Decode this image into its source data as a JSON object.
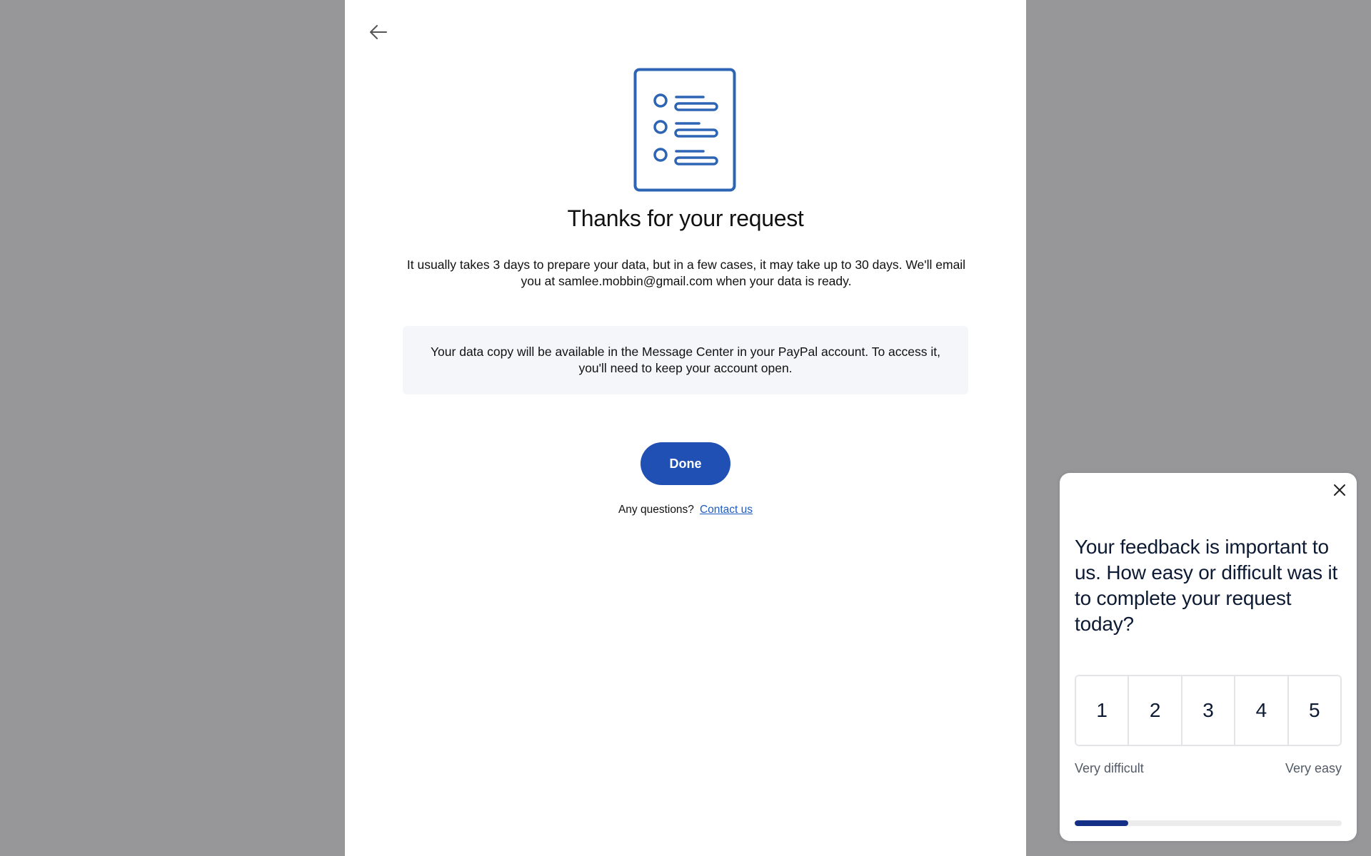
{
  "main": {
    "title": "Thanks for your request",
    "description": "It usually takes 3 days to prepare your data, but in a few cases, it may take up to 30 days. We'll email you at samlee.mobbin@gmail.com when your data is ready.",
    "info_box": "Your data copy will be available in the Message Center in your PayPal account. To access it, you'll need to keep your account open.",
    "done_label": "Done",
    "questions_label": "Any questions?",
    "contact_link": "Contact us"
  },
  "icons": {
    "back": "arrow-left-icon",
    "illustration": "document-list-icon",
    "close": "close-icon"
  },
  "feedback": {
    "question": "Your feedback is important to us. How easy or difficult was it to complete your request today?",
    "ratings": [
      "1",
      "2",
      "3",
      "4",
      "5"
    ],
    "low_label": "Very difficult",
    "high_label": "Very easy",
    "progress_fraction": 0.2
  },
  "colors": {
    "backdrop": "#97979a",
    "primary_button": "#2150b4",
    "link": "#1f5cbf",
    "illustration": "#2d64b3",
    "progress_fill": "#132f86"
  }
}
